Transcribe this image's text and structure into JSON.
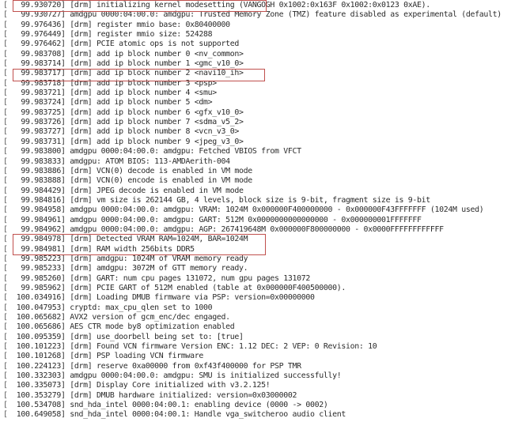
{
  "terminal": {
    "lines": [
      {
        "ts": "99.930720",
        "msg": "[drm] initializing kernel modesetting (VANGOGH 0x1002:0x163F 0x1002:0x0123 0xAE).",
        "highlighted": true
      },
      {
        "ts": "99.930727",
        "msg": "amdgpu 0000:04:00.0: amdgpu: Trusted Memory Zone (TMZ) feature disabled as experimental (default)"
      },
      {
        "ts": "99.976436",
        "msg": "[drm] register mmio base: 0x80400000"
      },
      {
        "ts": "99.976449",
        "msg": "[drm] register mmio size: 524288"
      },
      {
        "ts": "99.976462",
        "msg": "[drm] PCIE atomic ops is not supported"
      },
      {
        "ts": "99.983708",
        "msg": "[drm] add ip block number 0 <nv_common>"
      },
      {
        "ts": "99.983714",
        "msg": "[drm] add ip block number 1 <gmc_v10_0>"
      },
      {
        "ts": "99.983717",
        "msg": "[drm] add ip block number 2 <navi10_ih>",
        "highlighted": true
      },
      {
        "ts": "99.983718",
        "msg": "[drm] add ip block number 3 <psp>"
      },
      {
        "ts": "99.983721",
        "msg": "[drm] add ip block number 4 <smu>"
      },
      {
        "ts": "99.983724",
        "msg": "[drm] add ip block number 5 <dm>"
      },
      {
        "ts": "99.983725",
        "msg": "[drm] add ip block number 6 <gfx_v10_0>"
      },
      {
        "ts": "99.983726",
        "msg": "[drm] add ip block number 7 <sdma_v5_2>"
      },
      {
        "ts": "99.983727",
        "msg": "[drm] add ip block number 8 <vcn_v3_0>"
      },
      {
        "ts": "99.983731",
        "msg": "[drm] add ip block number 9 <jpeg_v3_0>"
      },
      {
        "ts": "99.983800",
        "msg": "amdgpu 0000:04:00.0: amdgpu: Fetched VBIOS from VFCT"
      },
      {
        "ts": "99.983833",
        "msg": "amdgpu: ATOM BIOS: 113-AMDAerith-004"
      },
      {
        "ts": "99.983886",
        "msg": "[drm] VCN(0) decode is enabled in VM mode"
      },
      {
        "ts": "99.983888",
        "msg": "[drm] VCN(0) encode is enabled in VM mode"
      },
      {
        "ts": "99.984429",
        "msg": "[drm] JPEG decode is enabled in VM mode"
      },
      {
        "ts": "99.984816",
        "msg": "[drm] vm size is 262144 GB, 4 levels, block size is 9-bit, fragment size is 9-bit"
      },
      {
        "ts": "99.984958",
        "msg": "amdgpu 0000:04:00.0: amdgpu: VRAM: 1024M 0x000000F400000000 - 0x000000F43FFFFFFF (1024M used)"
      },
      {
        "ts": "99.984961",
        "msg": "amdgpu 0000:04:00.0: amdgpu: GART: 512M 0x0000000000000000 - 0x000000001FFFFFFF"
      },
      {
        "ts": "99.984962",
        "msg": "amdgpu 0000:04:00.0: amdgpu: AGP: 267419648M 0x000000F800000000 - 0x0000FFFFFFFFFFFF"
      },
      {
        "ts": "99.984978",
        "msg": "[drm] Detected VRAM RAM=1024M, BAR=1024M",
        "highlighted": true
      },
      {
        "ts": "99.984981",
        "msg": "[drm] RAM width 256bits DDR5",
        "highlighted": true
      },
      {
        "ts": "99.985223",
        "msg": "[drm] amdgpu: 1024M of VRAM memory ready"
      },
      {
        "ts": "99.985233",
        "msg": "[drm] amdgpu: 3072M of GTT memory ready."
      },
      {
        "ts": "99.985260",
        "msg": "[drm] GART: num cpu pages 131072, num gpu pages 131072"
      },
      {
        "ts": "99.985962",
        "msg": "[drm] PCIE GART of 512M enabled (table at 0x000000F400500000)."
      },
      {
        "ts": "100.034916",
        "msg": "[drm] Loading DMUB firmware via PSP: version=0x00000000"
      },
      {
        "ts": "100.047953",
        "msg": "cryptd: max_cpu_qlen set to 1000"
      },
      {
        "ts": "100.065682",
        "msg": "AVX2 version of gcm_enc/dec engaged."
      },
      {
        "ts": "100.065686",
        "msg": "AES CTR mode by8 optimization enabled"
      },
      {
        "ts": "100.095359",
        "msg": "[drm] use_doorbell being set to: [true]"
      },
      {
        "ts": "100.101223",
        "msg": "[drm] Found VCN firmware Version ENC: 1.12 DEC: 2 VEP: 0 Revision: 10"
      },
      {
        "ts": "100.101268",
        "msg": "[drm] PSP loading VCN firmware"
      },
      {
        "ts": "100.224123",
        "msg": "[drm] reserve 0xa00000 from 0xf43f400000 for PSP TMR"
      },
      {
        "ts": "100.332303",
        "msg": "amdgpu 0000:04:00.0: amdgpu: SMU is initialized successfully!"
      },
      {
        "ts": "100.335073",
        "msg": "[drm] Display Core initialized with v3.2.125!"
      },
      {
        "ts": "100.353279",
        "msg": "[drm] DMUB hardware initialized: version=0x03000002"
      },
      {
        "ts": "100.534708",
        "msg": "snd_hda_intel 0000:04:00.1: enabling device (0000 -> 0002)"
      },
      {
        "ts": "100.649058",
        "msg": "snd_hda_intel 0000:04:00.1: Handle vga_switcheroo audio client"
      }
    ]
  },
  "colors": {
    "highlight_border": "#c0504d",
    "text": "#2b2b2b",
    "background": "#ffffff"
  }
}
